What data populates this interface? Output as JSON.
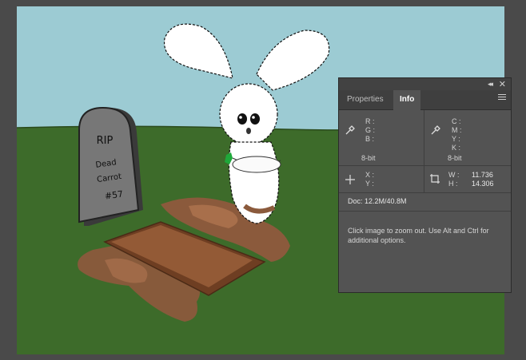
{
  "canvas_scene": {
    "tombstone_lines": [
      "RIP",
      "Dead",
      "Carrot",
      "#57"
    ]
  },
  "panel": {
    "tabs": [
      "Properties",
      "Info"
    ],
    "active_tab": "Info",
    "rgb": {
      "labels": [
        "R :",
        "G :",
        "B :"
      ],
      "bit_depth": "8-bit"
    },
    "cmyk": {
      "labels": [
        "C :",
        "M :",
        "Y :",
        "K :"
      ],
      "bit_depth": "8-bit"
    },
    "xy": {
      "labels": [
        "X :",
        "Y :"
      ]
    },
    "size": {
      "w_label": "W :",
      "w_value": "11.736",
      "h_label": "H :",
      "h_value": "14.306"
    },
    "doc": "Doc: 12.2M/40.8M",
    "hint": "Click image to zoom out. Use Alt and Ctrl for additional options."
  },
  "icons": [
    "collapse-icon",
    "close-icon",
    "panel-menu-icon",
    "eyedropper-icon",
    "crosshair-icon",
    "selection-size-icon"
  ]
}
